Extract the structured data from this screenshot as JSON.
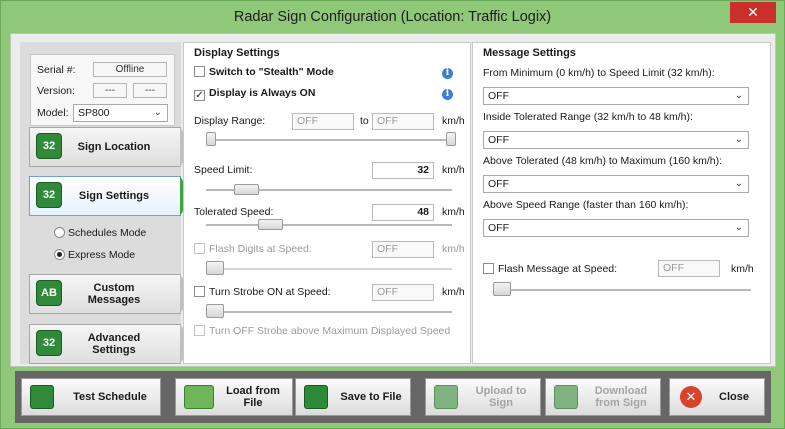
{
  "window": {
    "title": "Radar Sign Configuration (Location: Traffic Logix)",
    "close_glyph": "✕"
  },
  "device": {
    "serial_label": "Serial #:",
    "serial_value": "Offline",
    "version_label": "Version:",
    "version_a": "---",
    "version_b": "---",
    "model_label": "Model:",
    "model_value": "SP800"
  },
  "nav": {
    "items": [
      {
        "label": "Sign Location",
        "icon": "sign-location-icon"
      },
      {
        "label": "Sign Settings",
        "icon": "sign-settings-icon"
      },
      {
        "label": "Custom Messages",
        "icon": "custom-messages-icon"
      },
      {
        "label": "Advanced Settings",
        "icon": "advanced-settings-icon"
      }
    ],
    "modes": [
      {
        "label": "Schedules Mode",
        "selected": false
      },
      {
        "label": "Express Mode",
        "selected": true
      }
    ]
  },
  "display": {
    "title": "Display Settings",
    "stealth_label": "Switch to \"Stealth\" Mode",
    "stealth_checked": false,
    "always_on_label": "Display is Always ON",
    "always_on_checked": true,
    "range_label": "Display Range:",
    "range_from": "OFF",
    "range_to_label": "to",
    "range_to": "OFF",
    "unit": "km/h",
    "speed_limit_label": "Speed Limit:",
    "speed_limit_value": "32",
    "tolerated_label": "Tolerated Speed:",
    "tolerated_value": "48",
    "flash_label": "Flash Digits at Speed:",
    "flash_value": "OFF",
    "strobe_label": "Turn Strobe ON at Speed:",
    "strobe_value": "OFF",
    "strobe_off_label": "Turn OFF Strobe above Maximum Displayed Speed"
  },
  "message": {
    "title": "Message Settings",
    "ranges": [
      {
        "label": "From Minimum (0 km/h) to Speed Limit (32 km/h):",
        "value": "OFF"
      },
      {
        "label": "Inside Tolerated Range (32 km/h to 48 km/h):",
        "value": "OFF"
      },
      {
        "label": "Above Tolerated (48 km/h) to Maximum (160 km/h):",
        "value": "OFF"
      },
      {
        "label": "Above Speed Range (faster than 160 km/h):",
        "value": "OFF"
      }
    ],
    "flash_label": "Flash Message at Speed:",
    "flash_value": "OFF",
    "unit": "km/h"
  },
  "toolbar": {
    "test_schedule": "Test Schedule",
    "load_from_file": "Load from File",
    "save_to_file": "Save to File",
    "upload_to_sign": "Upload to Sign",
    "download_from_sign": "Download from Sign",
    "close": "Close"
  },
  "colors": {
    "accent_green": "#8ec878",
    "close_red": "#c9302c",
    "toolbar_bg": "#666666"
  }
}
